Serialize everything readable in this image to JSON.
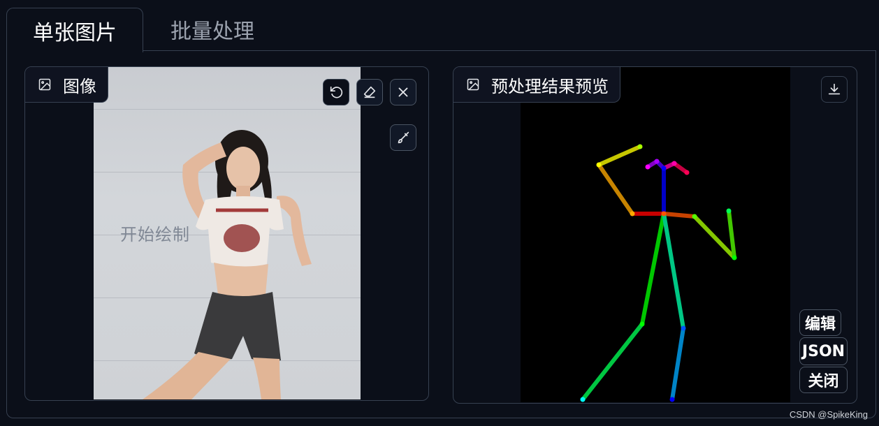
{
  "tabs": [
    {
      "label": "单张图片",
      "active": true
    },
    {
      "label": "批量处理",
      "active": false
    }
  ],
  "input_panel": {
    "label": "图像",
    "label_icon": "image-icon",
    "overlay_text": "开始绘制",
    "tools": [
      "undo-icon",
      "eraser-icon",
      "close-icon",
      "brush-icon"
    ]
  },
  "output_panel": {
    "label": "预处理结果预览",
    "label_icon": "image-icon",
    "download_icon": "download-icon",
    "buttons": {
      "edit": "编辑",
      "json": "JSON",
      "close": "关闭"
    }
  },
  "colors": {
    "background": "#0b0f19",
    "border": "#374151",
    "canvas": "#000000"
  },
  "watermark": "CSDN @SpikeKing"
}
